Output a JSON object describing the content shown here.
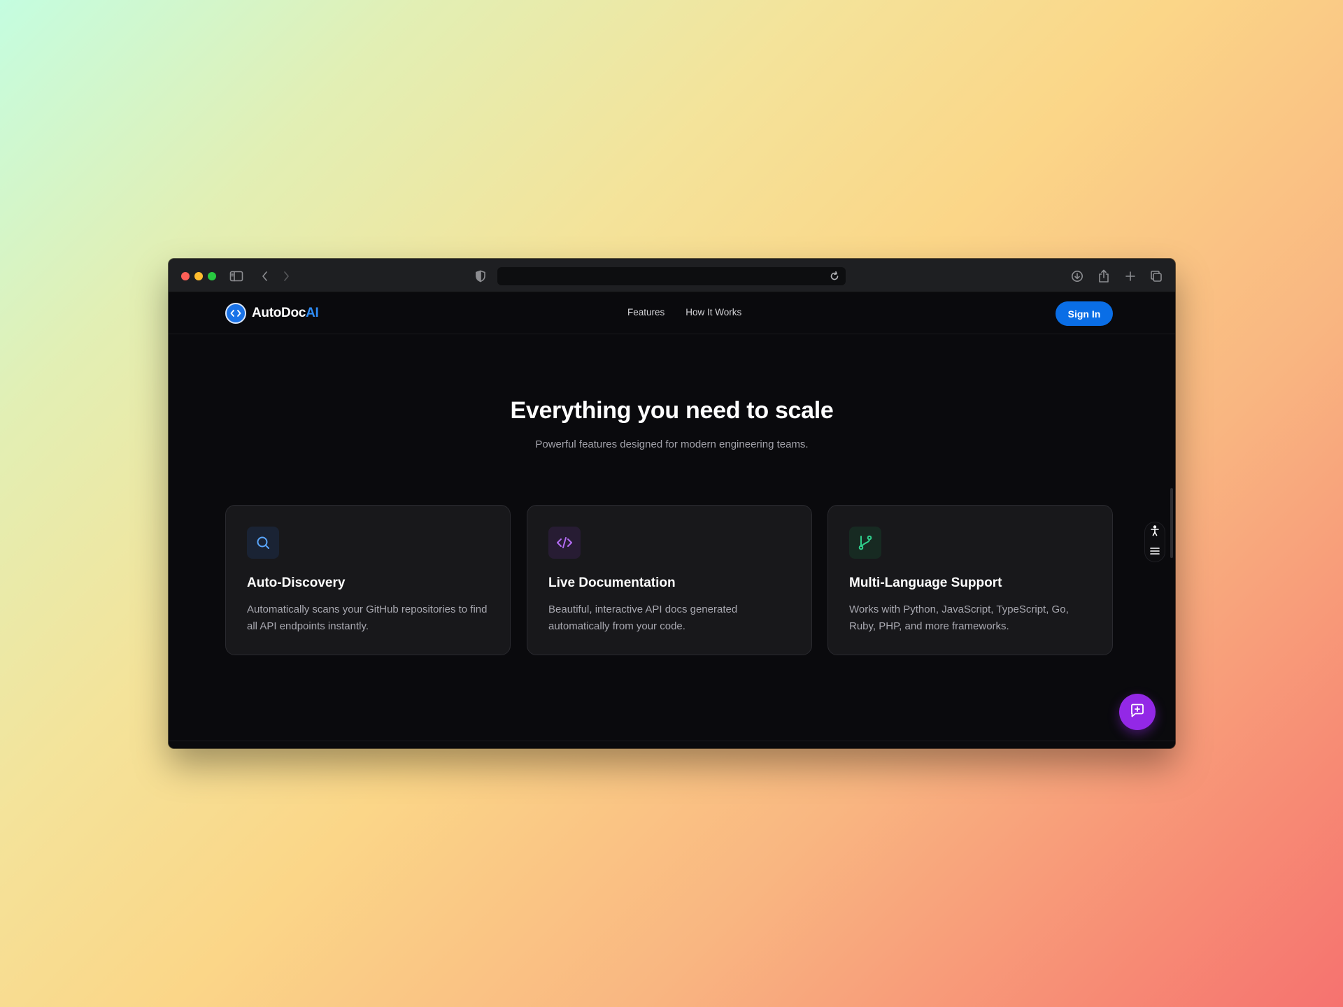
{
  "browser": {
    "url": "",
    "icons": [
      "sidebar-icon",
      "back-icon",
      "forward-icon",
      "shield-icon",
      "reload-icon",
      "download-icon",
      "share-icon",
      "new-tab-icon",
      "tabs-icon"
    ]
  },
  "nav": {
    "brand_main": "AutoDoc",
    "brand_accent": "AI",
    "links": [
      "Features",
      "How It Works"
    ],
    "signin_label": "Sign In"
  },
  "hero": {
    "title": "Everything you need to scale",
    "subtitle": "Powerful features designed for modern engineering teams."
  },
  "features": [
    {
      "icon": "search-icon",
      "title": "Auto-Discovery",
      "description": "Automatically scans your GitHub repositories to find all API endpoints instantly.",
      "icon_color": "#5aa7ff",
      "icon_bg": "#1a2334"
    },
    {
      "icon": "code-icon",
      "title": "Live Documentation",
      "description": "Beautiful, interactive API docs generated automatically from your code.",
      "icon_color": "#b46cf5",
      "icon_bg": "#271c33"
    },
    {
      "icon": "git-branch-icon",
      "title": "Multi-Language Support",
      "description": "Works with Python, JavaScript, TypeScript, Go, Ruby, PHP, and more frameworks.",
      "icon_color": "#2fcf8c",
      "icon_bg": "#172a22"
    }
  ],
  "colors": {
    "accent_blue": "#0a6ee6",
    "chat_purple": "#9328e6",
    "page_bg": "#0a0a0d"
  }
}
